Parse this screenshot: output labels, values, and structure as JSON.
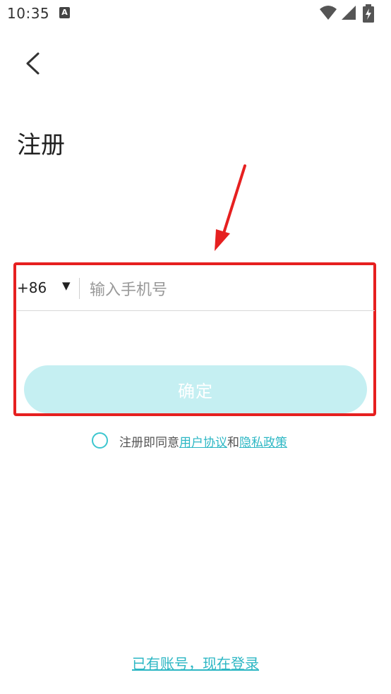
{
  "status_bar": {
    "time": "10:35",
    "app_icon_letter": "A",
    "icons": [
      "wifi-icon",
      "signal-icon",
      "battery-charging-icon"
    ]
  },
  "nav": {
    "back_icon": "chevron-left-icon"
  },
  "page": {
    "title": "注册"
  },
  "form": {
    "country_code": "+86",
    "dropdown_glyph": "▼",
    "phone_placeholder": "输入手机号",
    "phone_value": "",
    "confirm_label": "确定"
  },
  "agreement": {
    "prefix": "注册即同意",
    "user_agreement": "用户协议",
    "and": "和",
    "privacy_policy": "隐私政策"
  },
  "footer": {
    "login_prompt": "已有账号，现在登录"
  },
  "colors": {
    "accent": "#2db7c4",
    "button_disabled": "#c5eff2",
    "annotation_red": "#e62020"
  }
}
